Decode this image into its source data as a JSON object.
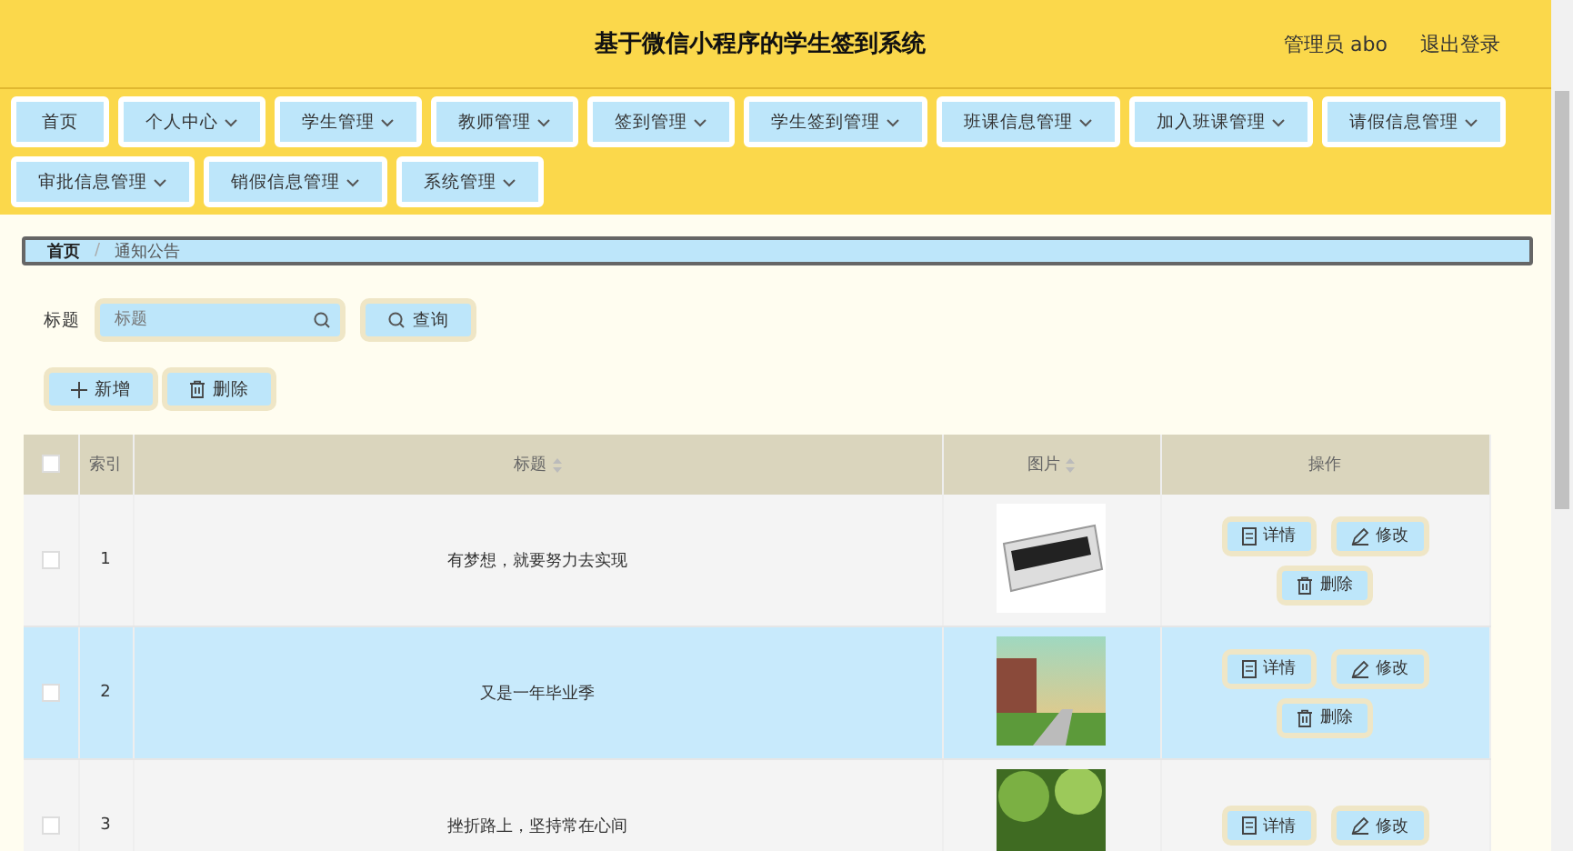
{
  "header": {
    "title": "基于微信小程序的学生签到系统",
    "user": "管理员 abo",
    "logout": "退出登录"
  },
  "nav": [
    {
      "label": "首页",
      "has_menu": false
    },
    {
      "label": "个人中心",
      "has_menu": true
    },
    {
      "label": "学生管理",
      "has_menu": true
    },
    {
      "label": "教师管理",
      "has_menu": true
    },
    {
      "label": "签到管理",
      "has_menu": true
    },
    {
      "label": "学生签到管理",
      "has_menu": true
    },
    {
      "label": "班课信息管理",
      "has_menu": true
    },
    {
      "label": "加入班课管理",
      "has_menu": true
    },
    {
      "label": "请假信息管理",
      "has_menu": true
    },
    {
      "label": "审批信息管理",
      "has_menu": true
    },
    {
      "label": "销假信息管理",
      "has_menu": true
    },
    {
      "label": "系统管理",
      "has_menu": true
    }
  ],
  "breadcrumb": {
    "items": [
      "首页",
      "通知公告"
    ],
    "separator": "/"
  },
  "search": {
    "label": "标题",
    "placeholder": "标题",
    "button": "查询"
  },
  "actions": {
    "add": "新增",
    "delete": "删除"
  },
  "table": {
    "all_checked": false,
    "columns": [
      "索引",
      "标题",
      "图片",
      "操作"
    ],
    "rows": [
      {
        "index": "1",
        "title": "有梦想，就要努力去实现",
        "selected": false,
        "checked": false,
        "buttons": [
          "详情",
          "修改",
          "删除"
        ]
      },
      {
        "index": "2",
        "title": "又是一年毕业季",
        "selected": true,
        "checked": false,
        "buttons": [
          "详情",
          "修改",
          "删除"
        ]
      },
      {
        "index": "3",
        "title": "挫折路上，坚持常在心间",
        "selected": false,
        "checked": false,
        "buttons": [
          "详情",
          "修改"
        ]
      }
    ]
  }
}
